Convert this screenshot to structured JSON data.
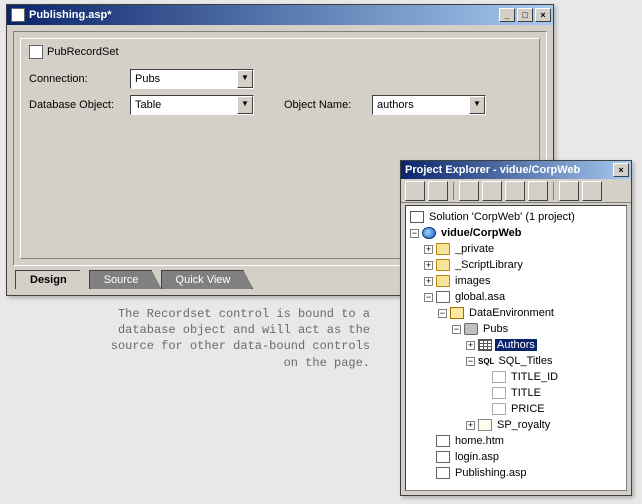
{
  "editor": {
    "title": "Publishing.asp*",
    "panel_title": "PubRecordSet",
    "labels": {
      "connection": "Connection:",
      "database_object": "Database Object:",
      "object_name": "Object Name:"
    },
    "values": {
      "connection": "Pubs",
      "database_object": "Table",
      "object_name": "authors"
    },
    "tabs": [
      "Design",
      "Source",
      "Quick View"
    ],
    "active_tab": 0
  },
  "caption": "The Recordset control is bound to a database object and will act as the source for other data-bound controls on the page.",
  "project_explorer": {
    "title": "Project Explorer - vidue/CorpWeb",
    "tree": {
      "solution": "Solution 'CorpWeb' (1 project)",
      "project": "vidue/CorpWeb",
      "nodes": [
        "_private",
        "_ScriptLibrary",
        "images",
        "global.asa",
        "DataEnvironment",
        "Pubs",
        "Authors",
        "SQL_Titles",
        "TITLE_ID",
        "TITLE",
        "PRICE",
        "SP_royalty",
        "home.htm",
        "login.asp",
        "Publishing.asp"
      ]
    }
  },
  "glyphs": {
    "minimize": "_",
    "maximize": "□",
    "close": "×",
    "dropdown": "▼",
    "plus": "+",
    "minus": "−"
  }
}
